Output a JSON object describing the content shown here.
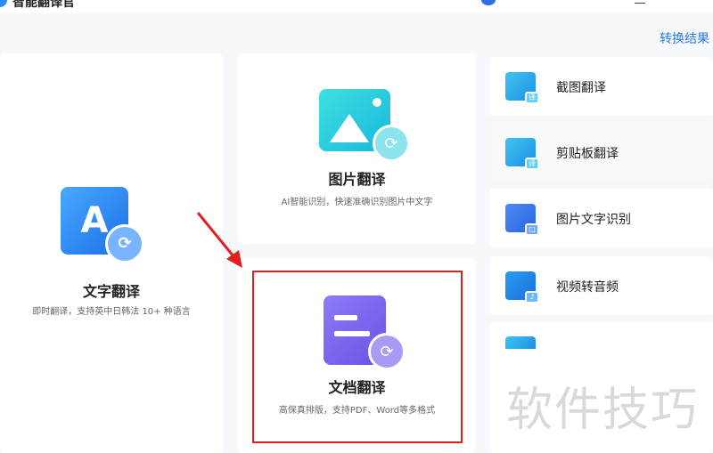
{
  "app": {
    "title": "智能翻译官"
  },
  "header": {
    "result_link": "转换结果"
  },
  "cards": {
    "text": {
      "title": "文字翻译",
      "desc": "即时翻译，支持英中日韩法 10+ 种语言"
    },
    "image": {
      "title": "图片翻译",
      "desc": "AI智能识别，快速准确识别图片中文字"
    },
    "doc": {
      "title": "文档翻译",
      "desc": "高保真排版，支持PDF、Word等多格式"
    }
  },
  "side": [
    {
      "label": "截图翻译"
    },
    {
      "label": "剪贴板翻译"
    },
    {
      "label": "图片文字识别"
    },
    {
      "label": "视频转音频"
    }
  ],
  "watermark": "软件技巧",
  "colors": {
    "accent": "#2c7be5",
    "highlight": "#e02020"
  }
}
